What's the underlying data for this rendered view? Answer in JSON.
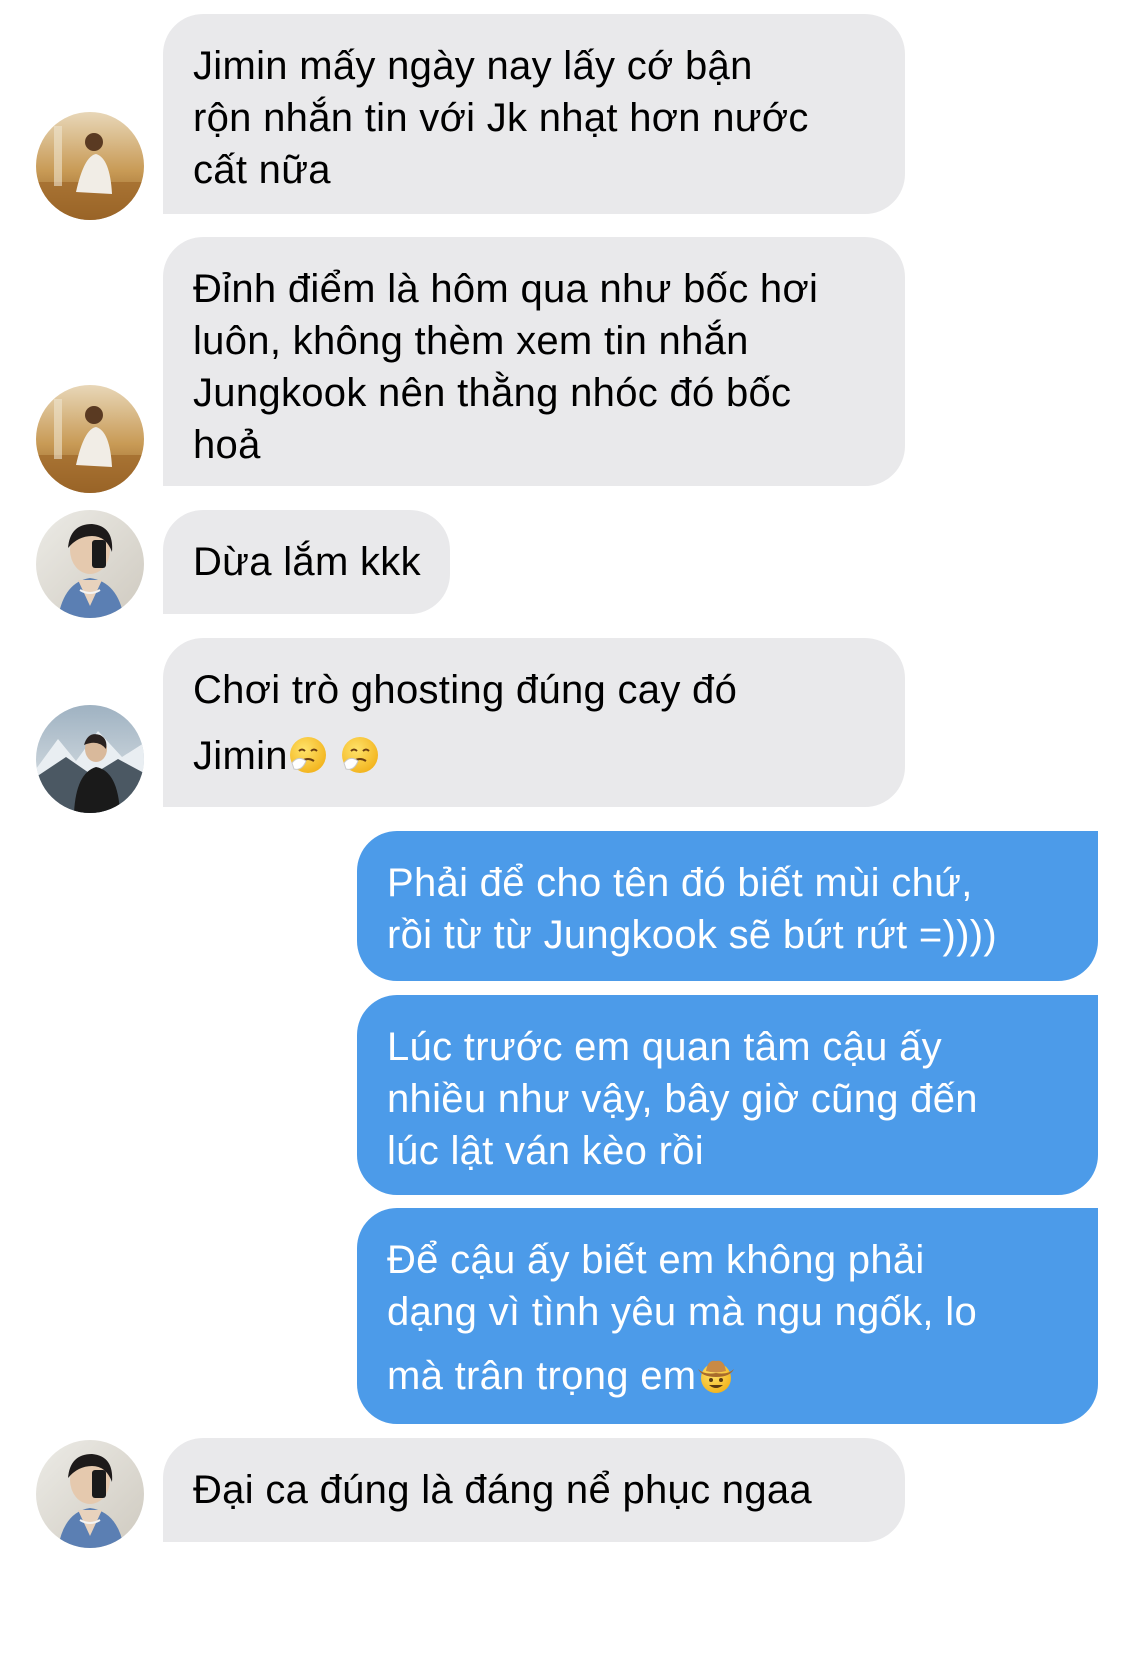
{
  "colors": {
    "incoming_bubble": "#e9e9eb",
    "outgoing_bubble": "#4c9be9",
    "incoming_text": "#000000",
    "outgoing_text": "#ffffff"
  },
  "messages": [
    {
      "direction": "incoming",
      "avatar": "avatar-golden-portrait",
      "lines": [
        "Jimin mấy ngày nay lấy cớ bận",
        "rộn nhắn tin với Jk nhạt hơn nước",
        "cất nữa"
      ]
    },
    {
      "direction": "incoming",
      "avatar": "avatar-golden-portrait",
      "lines": [
        "Đỉnh điểm là hôm qua như bốc hơi",
        "luôn, không thèm xem tin nhắn",
        "Jungkook nên thằng nhóc đó bốc",
        "hoả"
      ]
    },
    {
      "direction": "incoming",
      "avatar": "avatar-mirror-selfie",
      "lines": [
        "Dừa lắm kkk"
      ]
    },
    {
      "direction": "incoming",
      "avatar": "avatar-mountain-portrait",
      "lines": [
        "Chơi trò ghosting đúng cay đó",
        "Jimin"
      ],
      "emoji": [
        "sneezing-face-emoji",
        "sneezing-face-emoji"
      ]
    },
    {
      "direction": "outgoing",
      "lines": [
        "Phải để cho tên đó biết mùi chứ,",
        "rồi từ từ Jungkook sẽ bứt rứt =))))"
      ]
    },
    {
      "direction": "outgoing",
      "lines": [
        "Lúc trước em quan tâm cậu ấy",
        "nhiều như vậy, bây giờ cũng đến",
        "lúc lật ván kèo rồi"
      ]
    },
    {
      "direction": "outgoing",
      "lines": [
        "Để cậu ấy biết em không phải",
        "dạng vì tình yêu mà ngu ngốk, lo",
        "mà trân trọng em"
      ],
      "emoji": [
        "cowboy-hat-face-emoji"
      ]
    },
    {
      "direction": "incoming",
      "avatar": "avatar-mirror-selfie",
      "lines": [
        "Đại ca đúng là đáng nể phục ngaa"
      ]
    }
  ]
}
